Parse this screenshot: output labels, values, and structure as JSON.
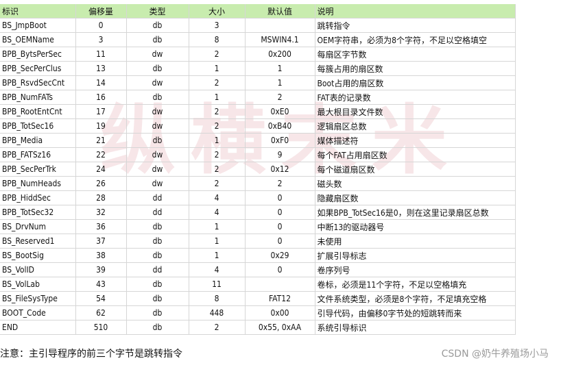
{
  "watermark": "纵横末米",
  "table": {
    "headers": [
      "标识",
      "偏移量",
      "类型",
      "大小",
      "默认值",
      "说明"
    ],
    "rows": [
      [
        "BS_JmpBoot",
        "0",
        "db",
        "3",
        "",
        "跳转指令"
      ],
      [
        "BS_OEMName",
        "3",
        "db",
        "8",
        "MSWIN4.1",
        "OEM字符串，必须为8个字符，不足以空格填空"
      ],
      [
        "BPB_BytsPerSec",
        "11",
        "dw",
        "2",
        "0x200",
        "每扇区字节数"
      ],
      [
        "BPB_SecPerClus",
        "13",
        "db",
        "1",
        "1",
        "每簇占用的扇区数"
      ],
      [
        "BPB_RsvdSecCnt",
        "14",
        "dw",
        "2",
        "1",
        "Boot占用的扇区数"
      ],
      [
        "BPB_NumFATs",
        "16",
        "db",
        "1",
        "2",
        "FAT表的记录数"
      ],
      [
        "BPB_RootEntCnt",
        "17",
        "dw",
        "2",
        "0xE0",
        "最大根目录文件数"
      ],
      [
        "BPB_TotSec16",
        "19",
        "dw",
        "2",
        "0xB40",
        "逻辑扇区总数"
      ],
      [
        "BPB_Media",
        "21",
        "db",
        "1",
        "0xF0",
        "媒体描述符"
      ],
      [
        "BPB_FATSz16",
        "22",
        "dw",
        "2",
        "9",
        "每个FAT占用扇区数"
      ],
      [
        "BPB_SecPerTrk",
        "24",
        "dw",
        "2",
        "0x12",
        "每个磁道扇区数"
      ],
      [
        "BPB_NumHeads",
        "26",
        "dw",
        "2",
        "2",
        "磁头数"
      ],
      [
        "BPB_HiddSec",
        "28",
        "dd",
        "4",
        "0",
        "隐藏扇区数"
      ],
      [
        "BPB_TotSec32",
        "32",
        "dd",
        "4",
        "0",
        "如果BPB_TotSec16是0，则在这里记录扇区总数"
      ],
      [
        "BS_DrvNum",
        "36",
        "db",
        "1",
        "0",
        "中断13的驱动器号"
      ],
      [
        "BS_Reserved1",
        "37",
        "db",
        "1",
        "0",
        "未使用"
      ],
      [
        "BS_BootSig",
        "38",
        "db",
        "1",
        "0x29",
        "扩展引导标志"
      ],
      [
        "BS_VolID",
        "39",
        "dd",
        "4",
        "0",
        "卷序列号"
      ],
      [
        "BS_VolLab",
        "43",
        "db",
        "11",
        "",
        "卷标，必须是11个字符，不足以空格填充"
      ],
      [
        "BS_FileSysType",
        "54",
        "db",
        "8",
        "FAT12",
        "文件系统类型，必须是8个字符，不足填充空格"
      ],
      [
        "BOOT_Code",
        "62",
        "db",
        "448",
        "0x00",
        "引导代码，由偏移0字节处的短跳转而来"
      ],
      [
        "END",
        "510",
        "db",
        "2",
        "0x55, 0xAA",
        "系统引导标识"
      ]
    ]
  },
  "note": "注意：主引导程序的前三个字节是跳转指令",
  "credit": "CSDN @奶牛养殖场小马",
  "colors": {
    "header_bg": "#c8ecae",
    "grid": "#d6d6d6",
    "credit_text": "#999999"
  }
}
